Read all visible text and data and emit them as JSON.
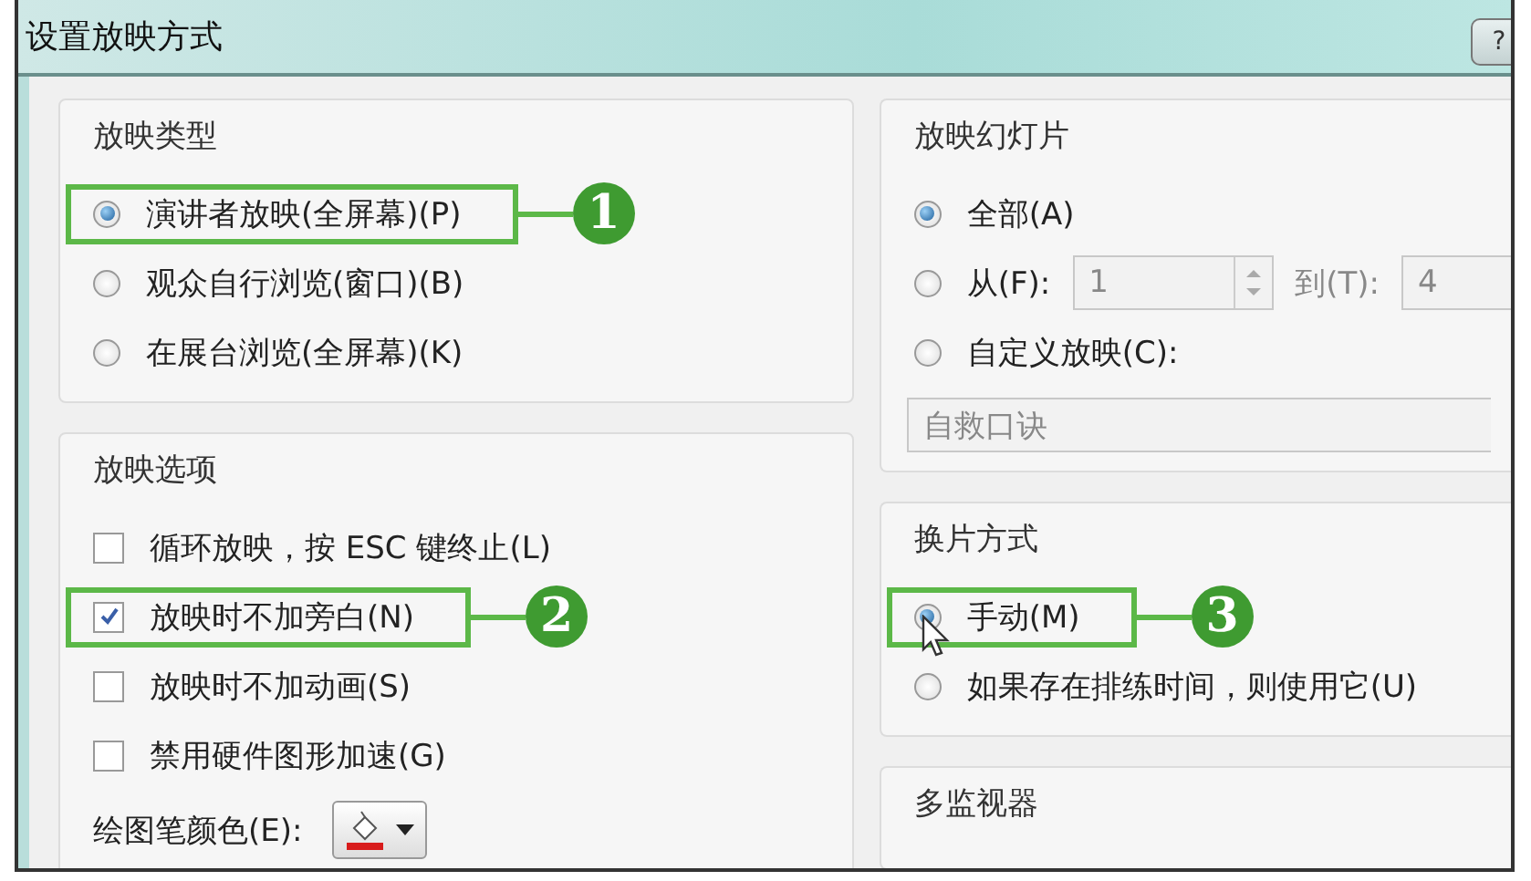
{
  "window": {
    "title": "设置放映方式",
    "help_button": "?"
  },
  "show_type": {
    "title": "放映类型",
    "options": [
      {
        "label": "演讲者放映(全屏幕)(P)",
        "selected": true,
        "callout": "1"
      },
      {
        "label": "观众自行浏览(窗口)(B)",
        "selected": false
      },
      {
        "label": "在展台浏览(全屏幕)(K)",
        "selected": false
      }
    ]
  },
  "show_options": {
    "title": "放映选项",
    "options": [
      {
        "label": "循环放映，按 ESC 键终止(L)",
        "checked": false
      },
      {
        "label": "放映时不加旁白(N)",
        "checked": true,
        "callout": "2"
      },
      {
        "label": "放映时不加动画(S)",
        "checked": false
      },
      {
        "label": "禁用硬件图形加速(G)",
        "checked": false
      }
    ],
    "pen_color": {
      "label": "绘图笔颜色(E):"
    }
  },
  "show_slides": {
    "title": "放映幻灯片",
    "options": [
      {
        "kind": "plain",
        "label": "全部(A)",
        "selected": true
      },
      {
        "kind": "range",
        "label": "从(F):",
        "selected": false,
        "from": "1",
        "to_label": "到(T):",
        "to": "4"
      },
      {
        "kind": "custom",
        "label": "自定义放映(C):",
        "selected": false,
        "value": "自救口诀"
      }
    ]
  },
  "advance": {
    "title": "换片方式",
    "options": [
      {
        "label": "手动(M)",
        "selected": true,
        "callout": "3",
        "pointer": true
      },
      {
        "label": "如果存在排练时间，则使用它(U)",
        "selected": false
      }
    ]
  },
  "monitors": {
    "title": "多监视器"
  }
}
